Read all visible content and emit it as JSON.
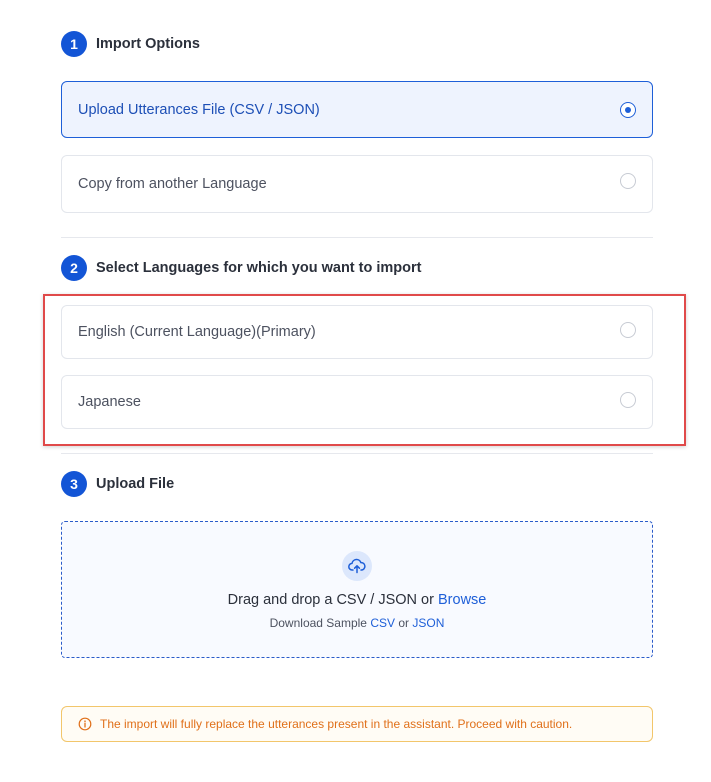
{
  "steps": [
    {
      "number": "1",
      "title": "Import Options"
    },
    {
      "number": "2",
      "title": "Select Languages for which you want to import"
    },
    {
      "number": "3",
      "title": "Upload File"
    }
  ],
  "import_options": [
    {
      "label": "Upload Utterances File (CSV / JSON)",
      "selected": true
    },
    {
      "label": "Copy from another Language",
      "selected": false
    }
  ],
  "languages": [
    {
      "label": "English (Current Language)(Primary)",
      "selected": false
    },
    {
      "label": "Japanese",
      "selected": false
    }
  ],
  "upload": {
    "icon": "cloud-upload-icon",
    "drag_text": "Drag and drop a CSV / JSON or",
    "browse_label": "Browse",
    "sample_prefix": "Download Sample",
    "csv_label": "CSV",
    "or_text": "or",
    "json_label": "JSON"
  },
  "warning": {
    "icon": "info-circle-icon",
    "text": "The import will fully replace the utterances present in the assistant. Proceed with caution."
  },
  "colors": {
    "accent": "#1e5fd8",
    "step_badge": "#1355d6",
    "highlight_border": "#e04a4a",
    "warning_text": "#e0701a",
    "warning_border": "#f2c66b"
  }
}
